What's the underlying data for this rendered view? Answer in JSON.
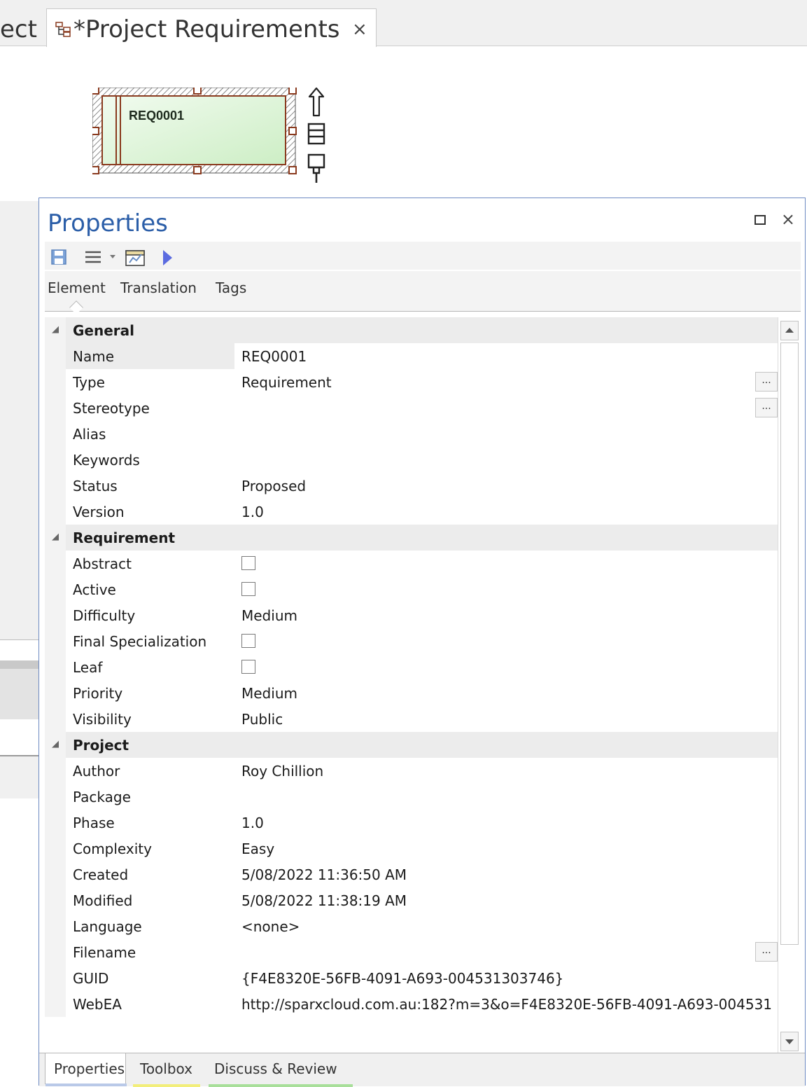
{
  "tabs": {
    "previous_tab_fragment": "ect",
    "active_tab_title": "*Project Requirements",
    "close_glyph": "×"
  },
  "diagram": {
    "element_name": "REQ0001"
  },
  "properties_window": {
    "title": "Properties",
    "close_glyph": "×",
    "toolbar": {
      "icons": [
        "save-icon",
        "menu-icon",
        "dropdown-arrow-icon",
        "open-properties-icon",
        "play-icon"
      ]
    },
    "subtabs": [
      "Element",
      "Translation",
      "Tags"
    ],
    "groups": [
      {
        "label": "General",
        "rows": [
          {
            "name": "Name",
            "value": "REQ0001"
          },
          {
            "name": "Type",
            "value": "Requirement",
            "ellipsis": true
          },
          {
            "name": "Stereotype",
            "value": "",
            "ellipsis": true
          },
          {
            "name": "Alias",
            "value": ""
          },
          {
            "name": "Keywords",
            "value": ""
          },
          {
            "name": "Status",
            "value": "Proposed"
          },
          {
            "name": "Version",
            "value": "1.0"
          }
        ]
      },
      {
        "label": "Requirement",
        "rows": [
          {
            "name": "Abstract",
            "checkbox": false
          },
          {
            "name": "Active",
            "checkbox": false
          },
          {
            "name": "Difficulty",
            "value": "Medium"
          },
          {
            "name": "Final Specialization",
            "checkbox": false
          },
          {
            "name": "Leaf",
            "checkbox": false
          },
          {
            "name": "Priority",
            "value": "Medium"
          },
          {
            "name": "Visibility",
            "value": "Public"
          }
        ]
      },
      {
        "label": "Project",
        "rows": [
          {
            "name": "Author",
            "value": "Roy Chillion"
          },
          {
            "name": "Package",
            "value": ""
          },
          {
            "name": "Phase",
            "value": "1.0"
          },
          {
            "name": "Complexity",
            "value": "Easy"
          },
          {
            "name": "Created",
            "value": "5/08/2022 11:36:50 AM"
          },
          {
            "name": "Modified",
            "value": "5/08/2022 11:38:19 AM"
          },
          {
            "name": "Language",
            "value": "<none>"
          },
          {
            "name": "Filename",
            "value": "",
            "ellipsis": true
          },
          {
            "name": "GUID",
            "value": "{F4E8320E-56FB-4091-A693-004531303746}"
          },
          {
            "name": "WebEA",
            "value": "http://sparxcloud.com.au:182?m=3&o=F4E8320E-56FB-4091-A693-004531..."
          }
        ]
      }
    ],
    "ellipsis_label": "...",
    "bottom_tabs": [
      {
        "label": "Properties",
        "color": "#b9c9e8"
      },
      {
        "label": "Toolbox",
        "color": "#f2ee7a"
      },
      {
        "label": "Discuss & Review",
        "color": "#a8df9a"
      }
    ]
  },
  "colors": {
    "accent_title": "#2b5ea8",
    "window_border": "#6d8ac2",
    "element_fill": "#d8f2d2",
    "element_border": "#8a3a1e"
  }
}
